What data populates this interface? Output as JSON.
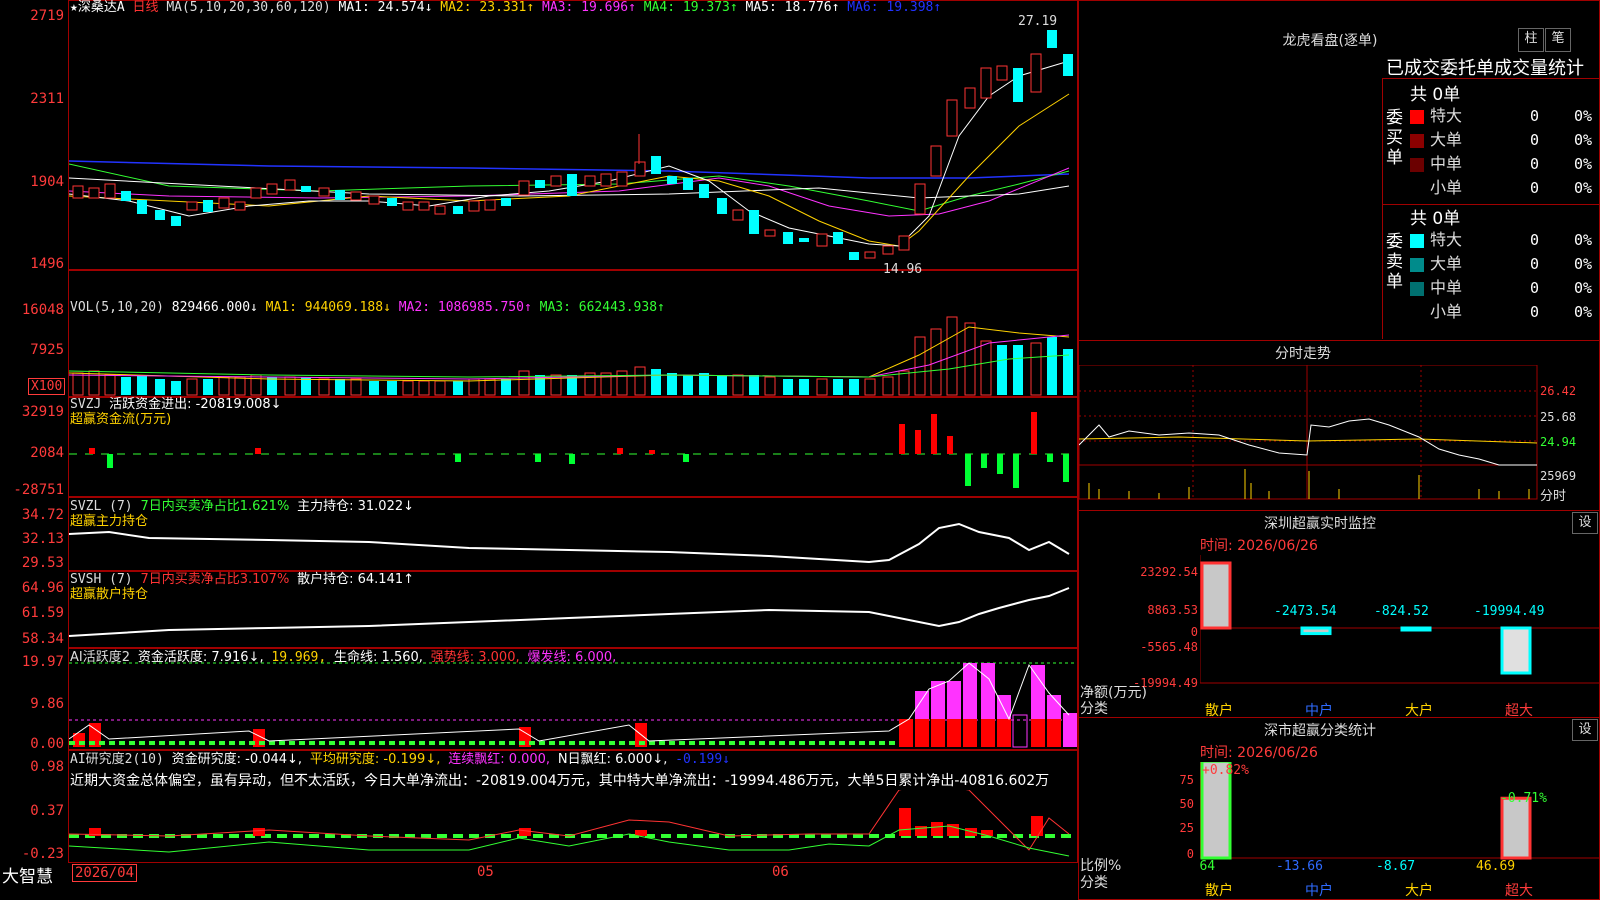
{
  "header": {
    "stock_name": "★深桑达A",
    "period": "日线",
    "ma_title": "MA(5,10,20,30,60,120)",
    "ma_items": [
      {
        "label": "MA1: 24.574↓",
        "color": "#ffffff"
      },
      {
        "label": "MA2: 23.331↑",
        "color": "#ffd200"
      },
      {
        "label": "MA3: 19.696↑",
        "color": "#ff33ff"
      },
      {
        "label": "MA4: 19.373↑",
        "color": "#33ff33"
      },
      {
        "label": "MA5: 18.776↑",
        "color": "#ffffff"
      },
      {
        "label": "MA6: 19.398↑",
        "color": "#2233ff"
      }
    ]
  },
  "price_axis": [
    "2719",
    "2311",
    "1904",
    "1496"
  ],
  "price_annotations": {
    "high": "27.19",
    "low": "14.96"
  },
  "vol_pane": {
    "title": "VOL(5,10,20)",
    "value": "829466.000↓",
    "items": [
      {
        "label": "MA1: 944069.188↓",
        "color": "#ffd200"
      },
      {
        "label": "MA2: 1086985.750↑",
        "color": "#ff33ff"
      },
      {
        "label": "MA3: 662443.938↑",
        "color": "#33ff33"
      }
    ],
    "axis": [
      "16048",
      "7925"
    ],
    "unit": "X100"
  },
  "svzj_pane": {
    "title": "SVZJ",
    "label": "活跃资金进出: -20819.008↓",
    "subtitle": "超赢资金流(万元)",
    "axis": [
      "32919",
      "2084",
      "-28751"
    ]
  },
  "svzl_pane": {
    "title": "SVZL (7)",
    "label_green": "7日内买卖净占比1.621%",
    "label": "主力持仓: 31.022↓",
    "subtitle": "超赢主力持仓",
    "axis": [
      "34.72",
      "32.13",
      "29.53"
    ]
  },
  "svsh_pane": {
    "title": "SVSH (7)",
    "label_red": "7日内买卖净占比3.107%",
    "label": "散户持仓: 64.141↑",
    "subtitle": "超赢散户持仓",
    "axis": [
      "64.96",
      "61.59",
      "58.34"
    ]
  },
  "ai_pane": {
    "title": "AI活跃度2",
    "items": [
      {
        "label": "资金活跃度: 7.916↓,",
        "color": "#ffffff"
      },
      {
        "label": "19.969,",
        "color": "#ffd200"
      },
      {
        "label": "生命线: 1.560,",
        "color": "#ffffff"
      },
      {
        "label": "强势线: 3.000,",
        "color": "#ff3333"
      },
      {
        "label": "爆发线: 6.000,",
        "color": "#ff33ff"
      }
    ],
    "axis": [
      "19.97",
      "9.86",
      "0.00"
    ]
  },
  "research_pane": {
    "title": "AI研究度2(10)",
    "items": [
      {
        "label": "资金研究度: -0.044↓,",
        "color": "#ffffff"
      },
      {
        "label": "平均研究度: -0.199↓,",
        "color": "#ffd200"
      },
      {
        "label": "连续飘红: 0.000,",
        "color": "#ff33ff"
      },
      {
        "label": "N日飘红: 6.000↓,",
        "color": "#ffffff"
      },
      {
        "label": "-0.199↓",
        "color": "#2233ff"
      }
    ],
    "summary": "近期大资金总体偏空，虽有异动，但不太活跃，今日大单净流出：-20819.004万元，其中特大单净流出：-19994.486万元，大单5日累计净出-40816.602万",
    "axis": [
      "0.98",
      "0.37",
      "-0.23"
    ]
  },
  "bottom": {
    "brand": "大智慧",
    "dates": [
      "2026/04",
      "05",
      "06"
    ]
  },
  "right_panel": {
    "title": "龙虎看盘(逐单)",
    "btn_bar": "柱",
    "btn_order": "笔",
    "section_title": "已成交委托单成交量统计",
    "buy": {
      "side": "委买单",
      "total": "共 0单",
      "rows": [
        {
          "label": "特大",
          "count": "0",
          "pct": "0%",
          "color": "#ff0000"
        },
        {
          "label": "大单",
          "count": "0",
          "pct": "0%",
          "color": "#8b0000"
        },
        {
          "label": "中单",
          "count": "0",
          "pct": "0%",
          "color": "#6b0000"
        },
        {
          "label": "小单",
          "count": "0",
          "pct": "0%",
          "color": "#000000"
        }
      ]
    },
    "sell": {
      "side": "委卖单",
      "total": "共 0单",
      "rows": [
        {
          "label": "特大",
          "count": "0",
          "pct": "0%",
          "color": "#00ffff"
        },
        {
          "label": "大单",
          "count": "0",
          "pct": "0%",
          "color": "#008b8b"
        },
        {
          "label": "中单",
          "count": "0",
          "pct": "0%",
          "color": "#007070"
        },
        {
          "label": "小单",
          "count": "0",
          "pct": "0%",
          "color": "#000000"
        }
      ]
    },
    "intraday": {
      "title": "分时走势",
      "axis": [
        "26.42",
        "25.68",
        "24.94",
        "25969"
      ],
      "unit": "分时"
    },
    "monitor": {
      "title": "深圳超赢实时监控",
      "btn": "设",
      "time": "时间: 2026/06/26",
      "axis": [
        "23292.54",
        "8863.53",
        "0",
        "-5565.48",
        "-19994.49"
      ],
      "yname": "净额(万元)",
      "xname": "分类",
      "categories": [
        "散户",
        "中户",
        "大户",
        "超大"
      ],
      "values": [
        "23292.54",
        "-2473.54",
        "-824.52",
        "-19994.49"
      ]
    },
    "stats": {
      "title": "深市超赢分类统计",
      "btn": "设",
      "time": "时间: 2026/06/26",
      "axis": [
        "75",
        "50",
        "25",
        "0"
      ],
      "yname": "比例%",
      "xname": "分类",
      "categories": [
        "散户",
        "中户",
        "大户",
        "超大"
      ],
      "values": [
        "75.64",
        "-13.66",
        "-8.67",
        "46.69"
      ],
      "top_labels": [
        "+0.82%",
        "-0.71%"
      ]
    }
  },
  "chart_data": [
    {
      "type": "bar",
      "title": "深圳超赢实时监控",
      "ylabel": "净额(万元)",
      "xlabel": "分类",
      "categories": [
        "散户",
        "中户",
        "大户",
        "超大"
      ],
      "values": [
        23292.54,
        -2473.54,
        -824.52,
        -19994.49
      ],
      "ylim": [
        -19994.49,
        23292.54
      ]
    },
    {
      "type": "bar",
      "title": "深市超赢分类统计",
      "ylabel": "比例%",
      "xlabel": "分类",
      "categories": [
        "散户",
        "中户",
        "大户",
        "超大"
      ],
      "values": [
        75.64,
        -13.66,
        -8.67,
        46.69
      ],
      "ylim": [
        0,
        75
      ]
    }
  ]
}
